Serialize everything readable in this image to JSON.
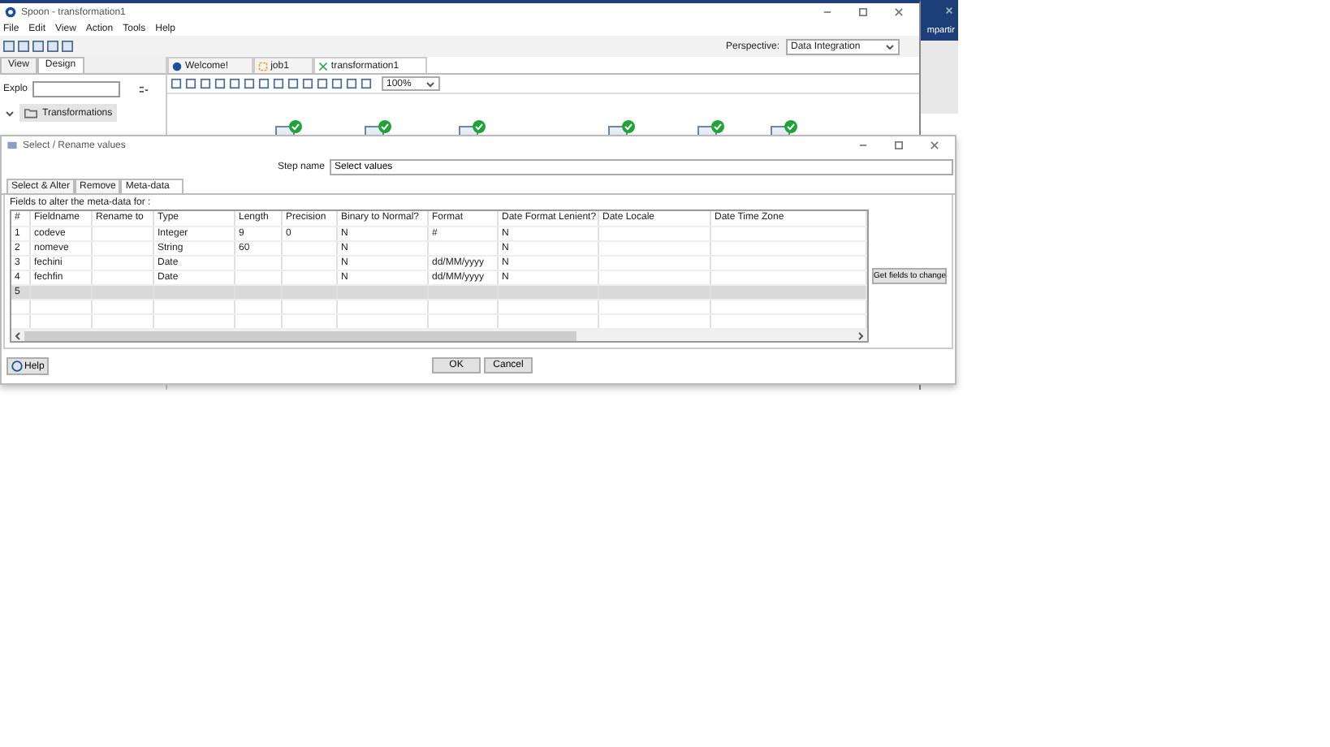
{
  "back_window": {
    "button": "mpartir"
  },
  "spoon": {
    "title": "Spoon - transformation1",
    "menu": [
      "File",
      "Edit",
      "View",
      "Action",
      "Tools",
      "Help"
    ],
    "perspective": {
      "label": "Perspective:",
      "value": "Data Integration"
    },
    "left_tabs": [
      {
        "label": "View",
        "selected": false
      },
      {
        "label": "Design",
        "selected": true
      }
    ],
    "explorer": {
      "label": "Explo"
    },
    "tree": [
      {
        "label": "Transformations",
        "expanded": true
      }
    ],
    "editor_tabs": [
      {
        "label": "Welcome!",
        "kind": "welcome",
        "selected": false
      },
      {
        "label": "job1",
        "kind": "job",
        "selected": false
      },
      {
        "label": "transformation1",
        "kind": "transformation",
        "selected": true
      }
    ],
    "zoom": "100%",
    "steps": [
      {
        "ok": true
      },
      {
        "ok": true
      },
      {
        "ok": true
      },
      {
        "ok": true
      },
      {
        "ok": true
      },
      {
        "ok": true
      }
    ]
  },
  "dialog": {
    "title": "Select / Rename values",
    "step_name": {
      "label": "Step name",
      "value": "Select values"
    },
    "tabs": [
      {
        "label": "Select & Alter",
        "selected": false
      },
      {
        "label": "Remove",
        "selected": false
      },
      {
        "label": "Meta-data",
        "selected": true
      }
    ],
    "caption": "Fields to alter the meta-data for :",
    "table": {
      "columns": [
        "#",
        "Fieldname",
        "Rename to",
        "Type",
        "Length",
        "Precision",
        "Binary to Normal?",
        "Format",
        "Date Format Lenient?",
        "Date Locale",
        "Date Time Zone"
      ],
      "rows": [
        {
          "cells": [
            "1",
            "codeve",
            "",
            "Integer",
            "9",
            "0",
            "N",
            "#",
            "N",
            "",
            ""
          ],
          "selected": false
        },
        {
          "cells": [
            "2",
            "nomeve",
            "",
            "String",
            "60",
            "",
            "N",
            "",
            "N",
            "",
            ""
          ],
          "selected": false
        },
        {
          "cells": [
            "3",
            "fechini",
            "",
            "Date",
            "",
            "",
            "N",
            "dd/MM/yyyy",
            "N",
            "",
            ""
          ],
          "selected": false
        },
        {
          "cells": [
            "4",
            "fechfin",
            "",
            "Date",
            "",
            "",
            "N",
            "dd/MM/yyyy",
            "N",
            "",
            ""
          ],
          "selected": false
        },
        {
          "cells": [
            "5",
            "",
            "",
            "",
            "",
            "",
            "",
            "",
            "",
            "",
            ""
          ],
          "selected": true
        }
      ]
    },
    "get_fields": "Get fields to change",
    "ok": "OK",
    "cancel": "Cancel",
    "help": "Help"
  }
}
